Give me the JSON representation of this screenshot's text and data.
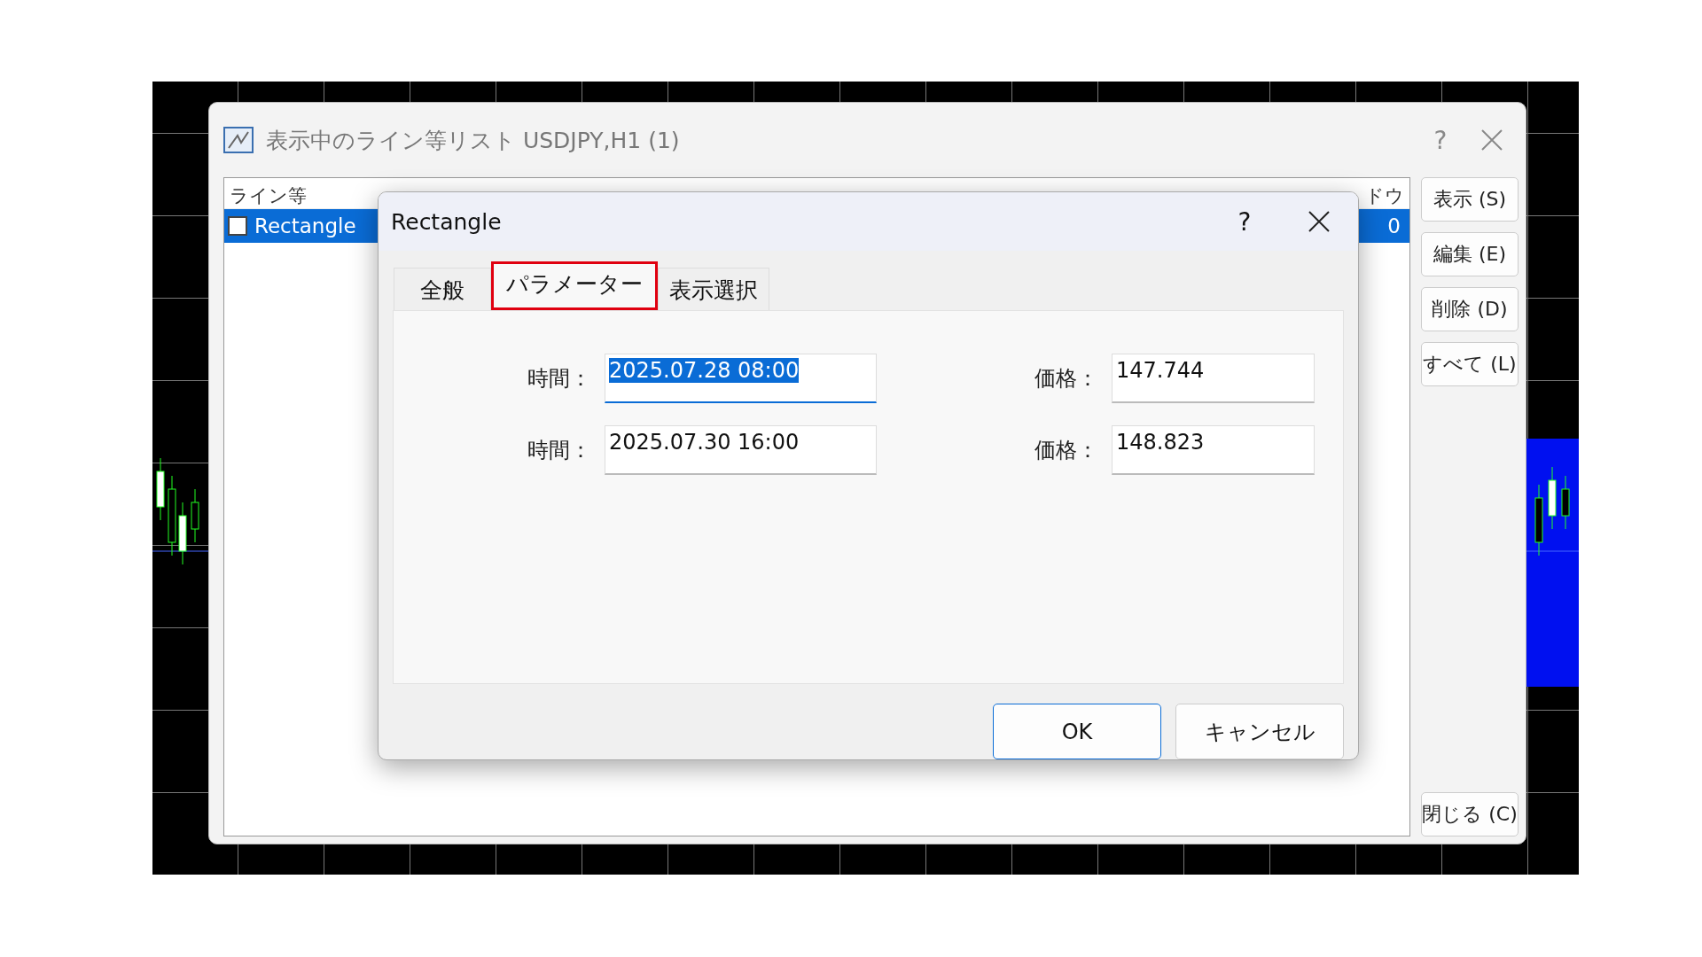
{
  "window": {
    "title": "表示中のライン等リスト USDJPY,H1 (1)",
    "help": "?"
  },
  "list": {
    "columns": [
      {
        "label": "ライン等"
      },
      {
        "label": "ドウ"
      }
    ],
    "rows": [
      {
        "name": "Rectangle",
        "checked": false,
        "selected": true,
        "window": "0"
      }
    ]
  },
  "side_buttons": [
    {
      "label": "表示 (S)"
    },
    {
      "label": "編集 (E)"
    },
    {
      "label": "削除 (D)"
    },
    {
      "label": "すべて (L)"
    }
  ],
  "close_button": {
    "label": "閉じる (C)"
  },
  "dialog": {
    "title": "Rectangle",
    "help": "?",
    "tabs": [
      {
        "label": "全般",
        "selected": false,
        "highlighted": false
      },
      {
        "label": "パラメーター",
        "selected": true,
        "highlighted": true
      },
      {
        "label": "表示選択",
        "selected": false,
        "highlighted": false
      }
    ],
    "fields": [
      {
        "label": "時間：",
        "value": "2025.07.28 08:00",
        "focused": true
      },
      {
        "label": "価格：",
        "value": "147.744",
        "focused": false
      },
      {
        "label": "時間：",
        "value": "2025.07.30 16:00",
        "focused": false
      },
      {
        "label": "価格：",
        "value": "148.823",
        "focused": false
      }
    ],
    "buttons": [
      {
        "label": "OK",
        "default": true
      },
      {
        "label": "キャンセル",
        "default": false
      }
    ]
  }
}
